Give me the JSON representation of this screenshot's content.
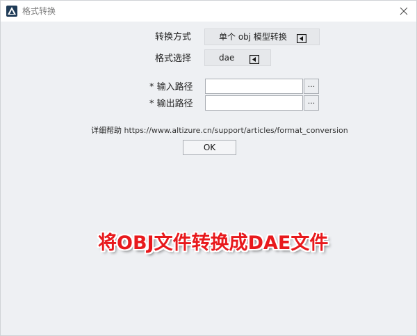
{
  "window": {
    "title": "格式转换",
    "close_glyph": "×",
    "icons": {
      "app": "app-logo-icon",
      "close": "close-icon"
    }
  },
  "form": {
    "conversion_mode": {
      "label": "转换方式",
      "value": "单个 obj 模型转换"
    },
    "format_select": {
      "label": "格式选择",
      "value": "dae"
    },
    "input_path": {
      "label": "* 输入路径",
      "value": "",
      "browse_label": "..."
    },
    "output_path": {
      "label": "* 输出路径",
      "value": "",
      "browse_label": "..."
    }
  },
  "help": {
    "label": "详细帮助",
    "url": "https://www.altizure.cn/support/articles/format_conversion"
  },
  "ok_button": "OK",
  "overlay_caption": "将OBJ文件转换成DAE文件",
  "colors": {
    "caption": "#e8191c",
    "background": "#eef0f3"
  }
}
